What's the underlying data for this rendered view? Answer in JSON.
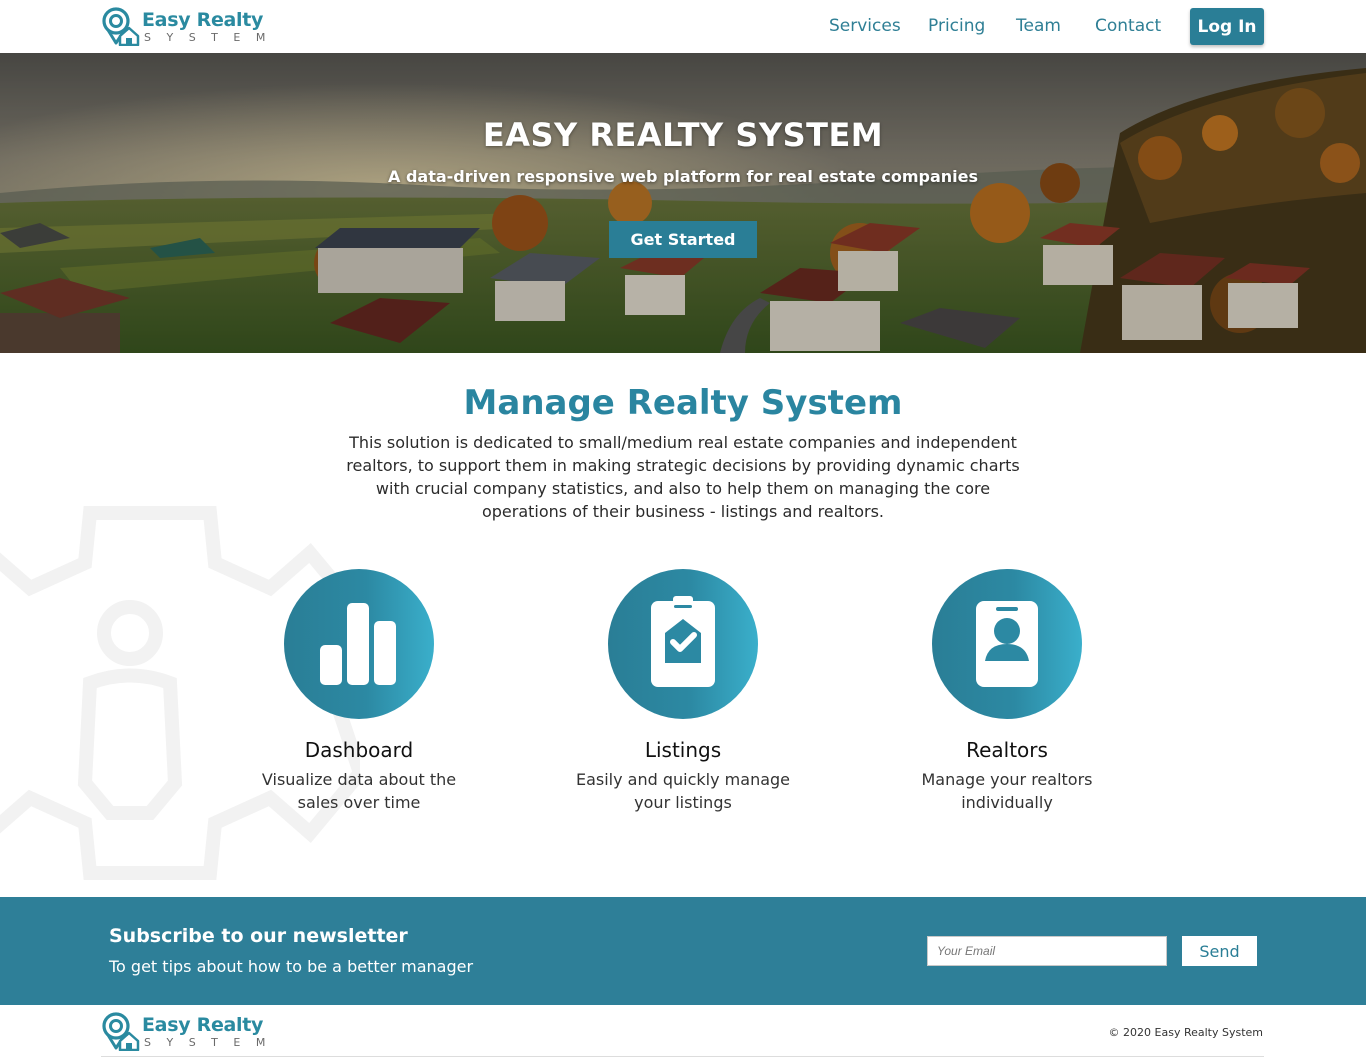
{
  "brand": {
    "name": "Easy Realty",
    "tagline": "SYSTEM",
    "accent_color": "#2a7e96"
  },
  "nav": {
    "items": [
      {
        "label": "Services"
      },
      {
        "label": "Pricing"
      },
      {
        "label": "Team"
      },
      {
        "label": "Contact"
      }
    ],
    "login_label": "Log In"
  },
  "hero": {
    "title": "EASY REALTY SYSTEM",
    "subtitle": "A data-driven responsive web platform for real estate companies",
    "cta_label": "Get Started"
  },
  "manage": {
    "title": "Manage Realty System",
    "description": "This solution is dedicated to small/medium real estate companies and independent realtors, to support them in making strategic decisions by providing dynamic charts with crucial company statistics, and also to help them on managing the core operations of their business - listings and realtors.",
    "features": [
      {
        "icon": "bar-chart-icon",
        "title": "Dashboard",
        "text": "Visualize data about the sales over time"
      },
      {
        "icon": "clipboard-check-icon",
        "title": "Listings",
        "text": "Easily and quickly manage your listings"
      },
      {
        "icon": "id-badge-icon",
        "title": "Realtors",
        "text": "Manage your realtors individually"
      }
    ]
  },
  "newsletter": {
    "title": "Subscribe to our newsletter",
    "subtitle": "To get tips about how to be a better manager",
    "email_placeholder": "Your Email",
    "send_label": "Send"
  },
  "footer": {
    "copyright": "© 2020 Easy Realty System"
  }
}
